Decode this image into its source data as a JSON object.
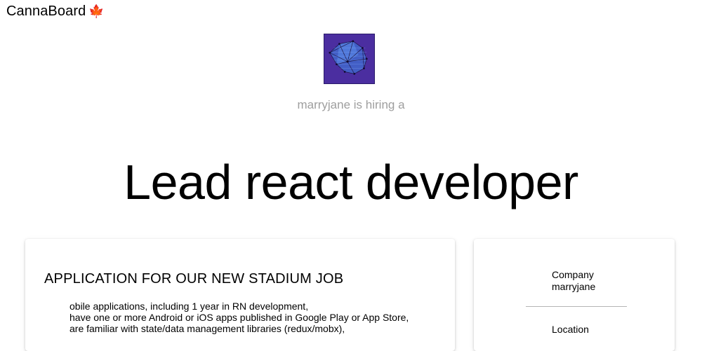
{
  "app": {
    "brand": "CannaBoard",
    "brand_icon": "maple-leaf-icon"
  },
  "header": {
    "hiring_text": "marryjane is hiring a",
    "job_title": "Lead react developer"
  },
  "main_card": {
    "heading": "APPLICATION FOR OUR NEW STADIUM JOB",
    "lines": [
      "obile applications, including 1 year in RN development,",
      "have one or more Android or iOS apps published in Google Play or App Store,",
      "are familiar with state/data management libraries (redux/mobx),"
    ]
  },
  "side_card": {
    "company_label": "Company",
    "company_value": "marryjane",
    "location_label": "Location"
  },
  "colors": {
    "logo_bg": "#4b2ea0",
    "hiring_text": "#9e9e9e"
  }
}
